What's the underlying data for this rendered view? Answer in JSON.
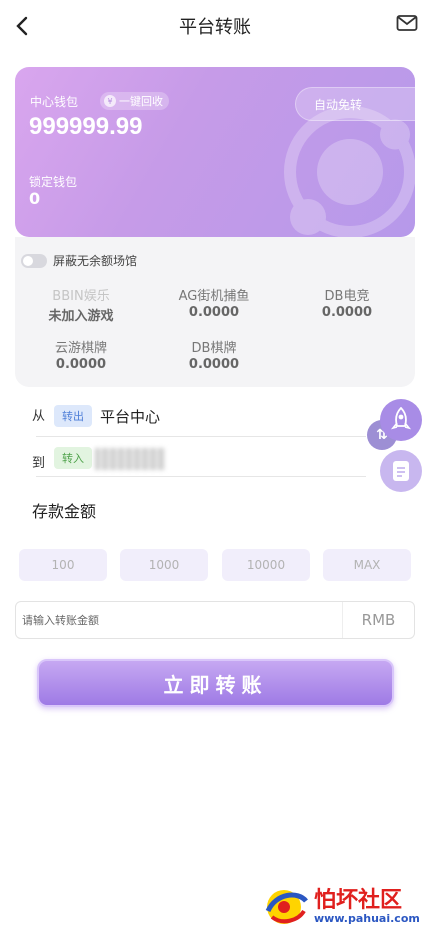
{
  "header": {
    "title": "平台转账",
    "back_icon": "chevron-left-icon",
    "mail_icon": "mail-icon"
  },
  "wallet": {
    "center_label": "中心钱包",
    "reclaim_label": "一键回收",
    "reclaim_icon_glyph": "¥",
    "auto_transfer_label": "自动免转",
    "balance": "999999.99",
    "locked_label": "锁定钱包",
    "locked_value": "0"
  },
  "venues_panel": {
    "hide_empty_label": "屏蔽无余额场馆",
    "hide_empty_on": false,
    "venues": [
      {
        "name": "BBIN娱乐",
        "value": "未加入游戏"
      },
      {
        "name": "AG街机捕鱼",
        "value": "0.0000"
      },
      {
        "name": "DB电竞",
        "value": "0.0000"
      },
      {
        "name": "云游棋牌",
        "value": "0.0000"
      },
      {
        "name": "DB棋牌",
        "value": "0.0000"
      }
    ]
  },
  "transfer": {
    "from_label": "从",
    "from_tag": "转出",
    "from_name": "平台中心",
    "to_label": "到",
    "to_tag": "转入",
    "swap_glyph": "⇅"
  },
  "amount": {
    "section_label": "存款金额",
    "quick_amounts": [
      "100",
      "1000",
      "10000",
      "MAX"
    ],
    "placeholder": "请输入转账金额",
    "value": "",
    "unit": "RMB"
  },
  "submit_label": "立即转账",
  "watermark": {
    "title": "怕坏社区",
    "url": "www.pahuai.com"
  },
  "colors": {
    "accent": "#b699ea",
    "button": "#9e7ae5",
    "tag_out": "#4f7fd8",
    "tag_in": "#4ea24a"
  }
}
